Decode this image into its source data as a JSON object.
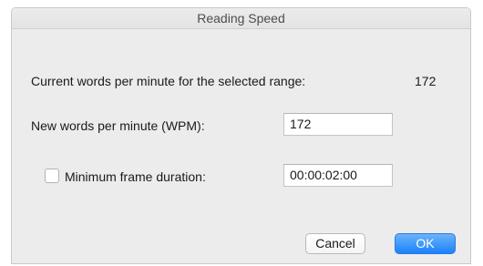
{
  "window": {
    "title": "Reading Speed"
  },
  "current": {
    "label": "Current words per minute for the selected range:",
    "value": "172"
  },
  "new_wpm": {
    "label": "New words per minute (WPM):",
    "value": "172"
  },
  "min_frame": {
    "checked": false,
    "label": "Minimum frame duration:",
    "value": "00:00:02:00"
  },
  "buttons": {
    "cancel": "Cancel",
    "ok": "OK"
  },
  "colors": {
    "dialog_background": "#ececec",
    "default_button": "#1a82fb"
  },
  "icons": {
    "checkbox": "checkbox-unchecked-icon"
  }
}
